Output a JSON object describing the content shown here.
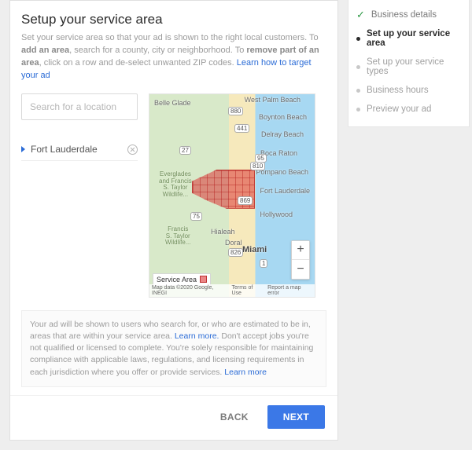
{
  "header": {
    "title": "Setup your service area",
    "desc_1": "Set your service area so that your ad is shown to the right local customers. To ",
    "desc_add": "add an area",
    "desc_2": ", search for a county, city or neighborhood. To ",
    "desc_remove": "remove part of an area",
    "desc_3": ", click on a row and de-select unwanted ZIP codes. ",
    "desc_link": "Learn how to target your ad"
  },
  "search": {
    "placeholder": "Search for a location"
  },
  "areas": [
    {
      "name": "Fort Lauderdale"
    }
  ],
  "map": {
    "legend": "Service Area",
    "attribution": "Map data ©2020 Google, INEGI",
    "terms": "Terms of Use",
    "report": "Report a map error",
    "cities": {
      "belle_glade": "Belle Glade",
      "west_palm_beach": "West Palm Beach",
      "boynton_beach": "Boynton Beach",
      "delray_beach": "Delray Beach",
      "boca_raton": "Boca Raton",
      "pompano_beach": "Pompano Beach",
      "fort_lauderdale": "Fort Lauderdale",
      "hollywood": "Hollywood",
      "hialeah": "Hialeah",
      "doral": "Doral",
      "miami": "Miami"
    },
    "parks": {
      "everglades1": "Everglades\nand Francis\nS. Taylor\nWildlife...",
      "everglades2": "Francis\nS. Taylor\nWildlife..."
    },
    "shields": {
      "a": "880",
      "b": "441",
      "c": "27",
      "d": "75",
      "e": "869",
      "f": "826",
      "g": "95",
      "h": "810",
      "i": "1"
    },
    "zoom_in": "+",
    "zoom_out": "−"
  },
  "disclaimer": {
    "t1": "Your ad will be shown to users who search for, or who are estimated to be in, areas that are within your service area. ",
    "link1": "Learn more.",
    "t2": " Don't accept jobs you're not qualified or licensed to complete. You're solely responsible for maintaining compliance with applicable laws, regulations, and licensing requirements in each jurisdiction where you offer or provide services. ",
    "link2": "Learn more"
  },
  "actions": {
    "back": "BACK",
    "next": "NEXT"
  },
  "steps": [
    {
      "label": "Business details",
      "state": "done"
    },
    {
      "label": "Set up your service area",
      "state": "active"
    },
    {
      "label": "Set up your service types",
      "state": "todo"
    },
    {
      "label": "Business hours",
      "state": "todo"
    },
    {
      "label": "Preview your ad",
      "state": "todo"
    }
  ]
}
